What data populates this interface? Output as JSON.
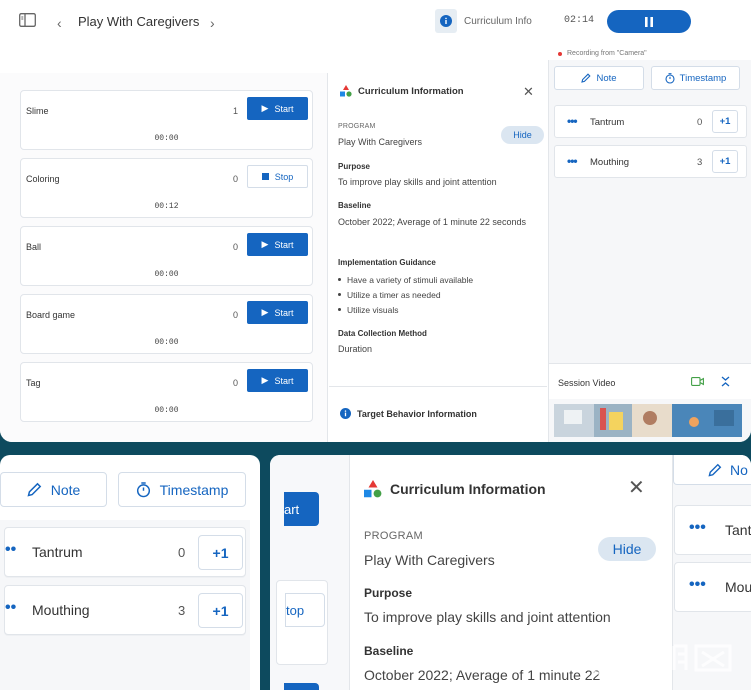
{
  "topbar": {
    "title": "Play With Caregivers",
    "curriculum_info_label": "Curriculum Info",
    "timer": "02:14",
    "recording_text": "Recording from \"Camera\""
  },
  "behaviors": [
    {
      "name": "Slime",
      "count": "1",
      "button": "Start",
      "time": "00:00"
    },
    {
      "name": "Coloring",
      "count": "0",
      "button": "Stop",
      "time": "00:12"
    },
    {
      "name": "Ball",
      "count": "0",
      "button": "Start",
      "time": "00:00"
    },
    {
      "name": "Board game",
      "count": "0",
      "button": "Start",
      "time": "00:00"
    },
    {
      "name": "Tag",
      "count": "0",
      "button": "Start",
      "time": "00:00"
    }
  ],
  "curriculum": {
    "header": "Curriculum Information",
    "program_label": "PROGRAM",
    "program_value": "Play With Caregivers",
    "hide_label": "Hide",
    "purpose_label": "Purpose",
    "purpose_value": "To improve play skills and joint attention",
    "baseline_label": "Baseline",
    "baseline_value": "October 2022; Average of 1 minute 22 seconds",
    "guidance_label": "Implementation Guidance",
    "guidance": [
      "Have a variety of stimuli available",
      "Utilize a timer as needed",
      "Utilize visuals"
    ],
    "method_label": "Data Collection Method",
    "method_value": "Duration",
    "target_behavior_label": "Target Behavior Information"
  },
  "right": {
    "note_label": "Note",
    "timestamp_label": "Timestamp",
    "frequency": [
      {
        "name": "Tantrum",
        "count": "0",
        "plus": "+1"
      },
      {
        "name": "Mouthing",
        "count": "3",
        "plus": "+1"
      }
    ],
    "session_video_label": "Session Video"
  },
  "zoom_mid": {
    "strip_start": "art",
    "strip_stop": "top",
    "program_value": "Play With Caregivers",
    "baseline_value": "October 2022; Average of 1 minute 22",
    "right_note": "No",
    "right_items": [
      "Tant",
      "Mou"
    ]
  },
  "colors": {
    "accent": "#1565c0",
    "background": "#0d4a5e"
  }
}
